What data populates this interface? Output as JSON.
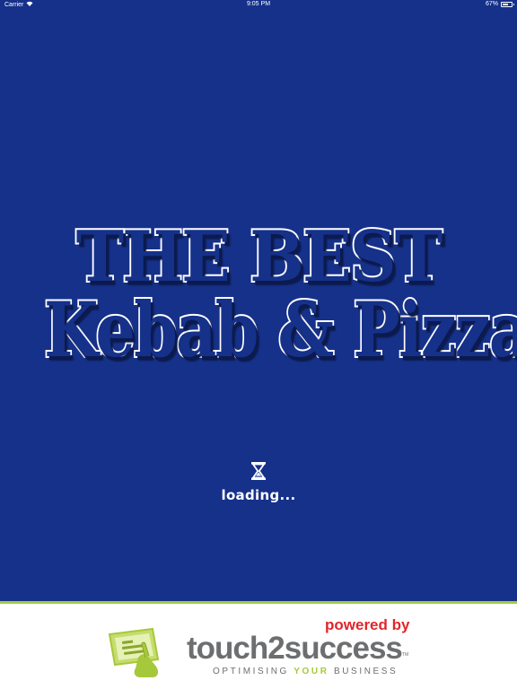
{
  "status_bar": {
    "carrier": "Carrier",
    "time": "9:05 PM",
    "battery": "67%",
    "battery_level": 0.67
  },
  "logo": {
    "line1": "THE BEST",
    "line2": "Kebab & Pizza"
  },
  "loading": {
    "icon": "hourglass-icon",
    "text": "loading..."
  },
  "footer": {
    "powered_by": "powered by",
    "brand": "touch2success",
    "trademark": "TM",
    "tagline_pre": "OPTIMISING ",
    "tagline_highlight": "YOUR",
    "tagline_post": " BUSINESS"
  },
  "colors": {
    "background": "#16318a",
    "footer_accent": "#a6c83b",
    "powered_by": "#e0262a",
    "brand_grey": "#6d6e70"
  }
}
